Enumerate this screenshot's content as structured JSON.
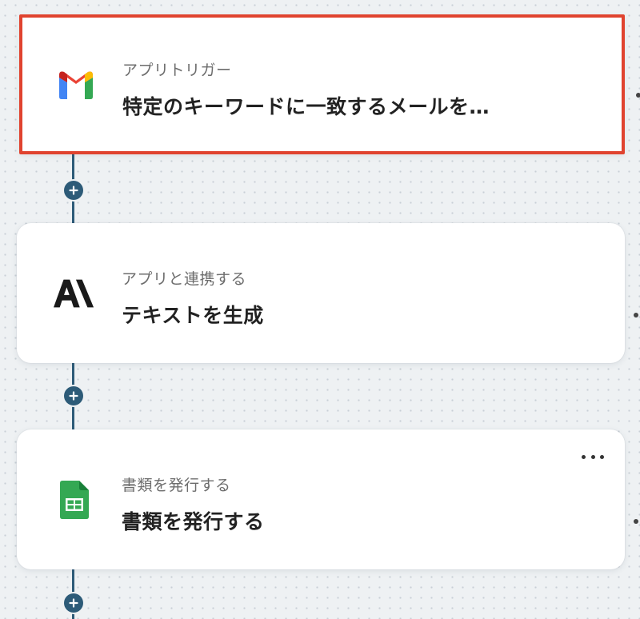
{
  "flow": {
    "steps": [
      {
        "subtitle": "アプリトリガー",
        "title": "特定のキーワードに一致するメールを…",
        "icon": "gmail-icon",
        "selected": true
      },
      {
        "subtitle": "アプリと連携する",
        "title": "テキストを生成",
        "icon": "anthropic-icon",
        "selected": false
      },
      {
        "subtitle": "書類を発行する",
        "title": "書類を発行する",
        "icon": "google-sheets-icon",
        "selected": false,
        "has_menu": true
      }
    ]
  },
  "colors": {
    "background": "#eef1f3",
    "connector": "#2d5b78",
    "selected_border": "#e0432f",
    "title_text": "#222222",
    "subtitle_text": "#6d6d6d"
  }
}
